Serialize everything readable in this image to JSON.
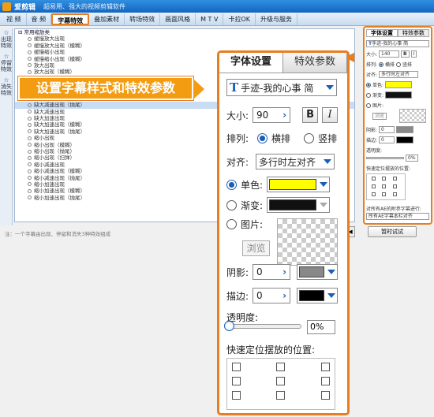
{
  "app": {
    "name": "爱剪辑",
    "slogan": "超易用、强大的视频剪辑软件"
  },
  "menu": {
    "tabs": [
      "视 频",
      "音 频",
      "字幕特效",
      "叠加素材",
      "转场特效",
      "画面风格",
      "M T V",
      "卡拉OK",
      "升级与服务"
    ],
    "active": "字幕特效"
  },
  "sidebar": {
    "items": [
      {
        "label": "出现特效"
      },
      {
        "label": "停留特效"
      },
      {
        "label": "消失特效"
      }
    ]
  },
  "effects_list": {
    "category": "常用缩放类",
    "items": [
      "缓慢放大出现",
      "缓慢放大出现（模糊）",
      "缓慢缩小出现",
      "缓慢缩小出现（模糊）",
      "放大出现",
      "放大出现（模糊）",
      "缩小出现",
      "缩小出现（模糊）",
      "缺大出现（模糊）",
      "缺大减速出现（模糊）",
      "缺大减速出现（抛尾）",
      "缺大减速出现",
      "缺大加速出现",
      "缺大加速出现（模糊）",
      "缺大加速出现（抛尾）",
      "缩小出现",
      "缩小出现（模糊）",
      "缩小出现（抛尾）",
      "缩小出现（扫弹）",
      "缩小减速出现",
      "缩小减速出现（模糊）",
      "缩小减速出现（抛尾）",
      "缩小加速出现",
      "缩小加速出现（模糊）",
      "缩小加速出现（抛尾）"
    ],
    "selected_index": 10
  },
  "status_note": "注：一个字幕由出现、停留和消失3种特效组成",
  "apply_button": "暂时试试",
  "callout": {
    "text": "设置字幕样式和特效参数"
  },
  "small_panel": {
    "tabs": [
      "字体设置",
      "特效参数"
    ],
    "font": "手迹-我的心事 简",
    "size_label": "大小:",
    "size": "140",
    "layout_label": "排列:",
    "horizontal": "横排",
    "vertical": "竖排",
    "align_label": "对齐:",
    "align": "多行时左对齐",
    "solid": "单色:",
    "gradient": "渐变:",
    "image": "图片:",
    "browse": "浏览",
    "shadow": "阴影:",
    "shadow_val": "0",
    "stroke": "描边:",
    "stroke_val": "0",
    "opacity": "透明度:",
    "opacity_val": "0%",
    "position": "快速定位摆放的位置:",
    "apply_all": "对所有AE的附参字幕进行:",
    "apply_sel": "所有AE字幕本栏对齐"
  },
  "big_panel": {
    "tabs": [
      "字体设置",
      "特效参数"
    ],
    "font": "手迹-我的心事 简",
    "size_label": "大小:",
    "size": "90",
    "bold": "B",
    "italic": "I",
    "layout_label": "排列:",
    "horizontal": "横排",
    "vertical": "竖排",
    "align_label": "对齐:",
    "align": "多行时左对齐",
    "solid_label": "单色:",
    "gradient_label": "渐变:",
    "image_label": "图片:",
    "browse": "浏览",
    "shadow_label": "阴影:",
    "shadow_val": "0",
    "stroke_label": "描边:",
    "stroke_val": "0",
    "opacity_label": "透明度:",
    "opacity_val": "0%",
    "position_label": "快速定位摆放的位置:",
    "opacity_level": 0
  },
  "colors": {
    "accent": "#e67e22",
    "solid_color": "#ffff00",
    "gradient_color": "#111111",
    "shadow_color": "#888888",
    "stroke_color": "#000000"
  }
}
